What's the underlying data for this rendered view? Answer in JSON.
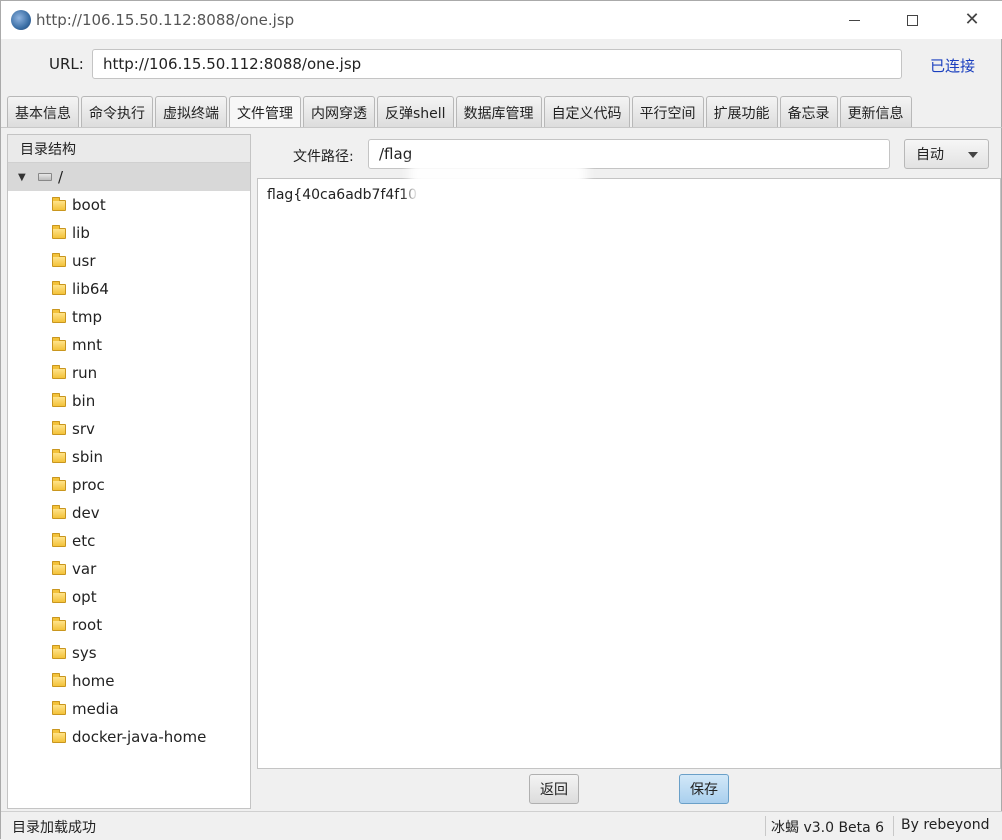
{
  "window": {
    "title": "http://106.15.50.112:8088/one.jsp"
  },
  "connection": {
    "url_label": "URL:",
    "url_value": "http://106.15.50.112:8088/one.jsp",
    "status": "已连接"
  },
  "tabs": [
    {
      "label": "基本信息"
    },
    {
      "label": "命令执行"
    },
    {
      "label": "虚拟终端"
    },
    {
      "label": "文件管理",
      "active": true
    },
    {
      "label": "内网穿透"
    },
    {
      "label": "反弹shell"
    },
    {
      "label": "数据库管理"
    },
    {
      "label": "自定义代码"
    },
    {
      "label": "平行空间"
    },
    {
      "label": "扩展功能"
    },
    {
      "label": "备忘录"
    },
    {
      "label": "更新信息"
    }
  ],
  "directory": {
    "header": "目录结构",
    "root": "/",
    "items": [
      "boot",
      "lib",
      "usr",
      "lib64",
      "tmp",
      "mnt",
      "run",
      "bin",
      "srv",
      "sbin",
      "proc",
      "dev",
      "etc",
      "var",
      "opt",
      "root",
      "sys",
      "home",
      "media",
      "docker-java-home"
    ]
  },
  "file": {
    "path_label": "文件路径:",
    "path_value": "/flag",
    "encoding": "自动",
    "content": "flag{40ca6adb7f4f10"
  },
  "actions": {
    "back": "返回",
    "save": "保存"
  },
  "statusbar": {
    "message": "目录加载成功",
    "version": "冰蝎 v3.0 Beta 6",
    "author": "By rebeyond"
  }
}
